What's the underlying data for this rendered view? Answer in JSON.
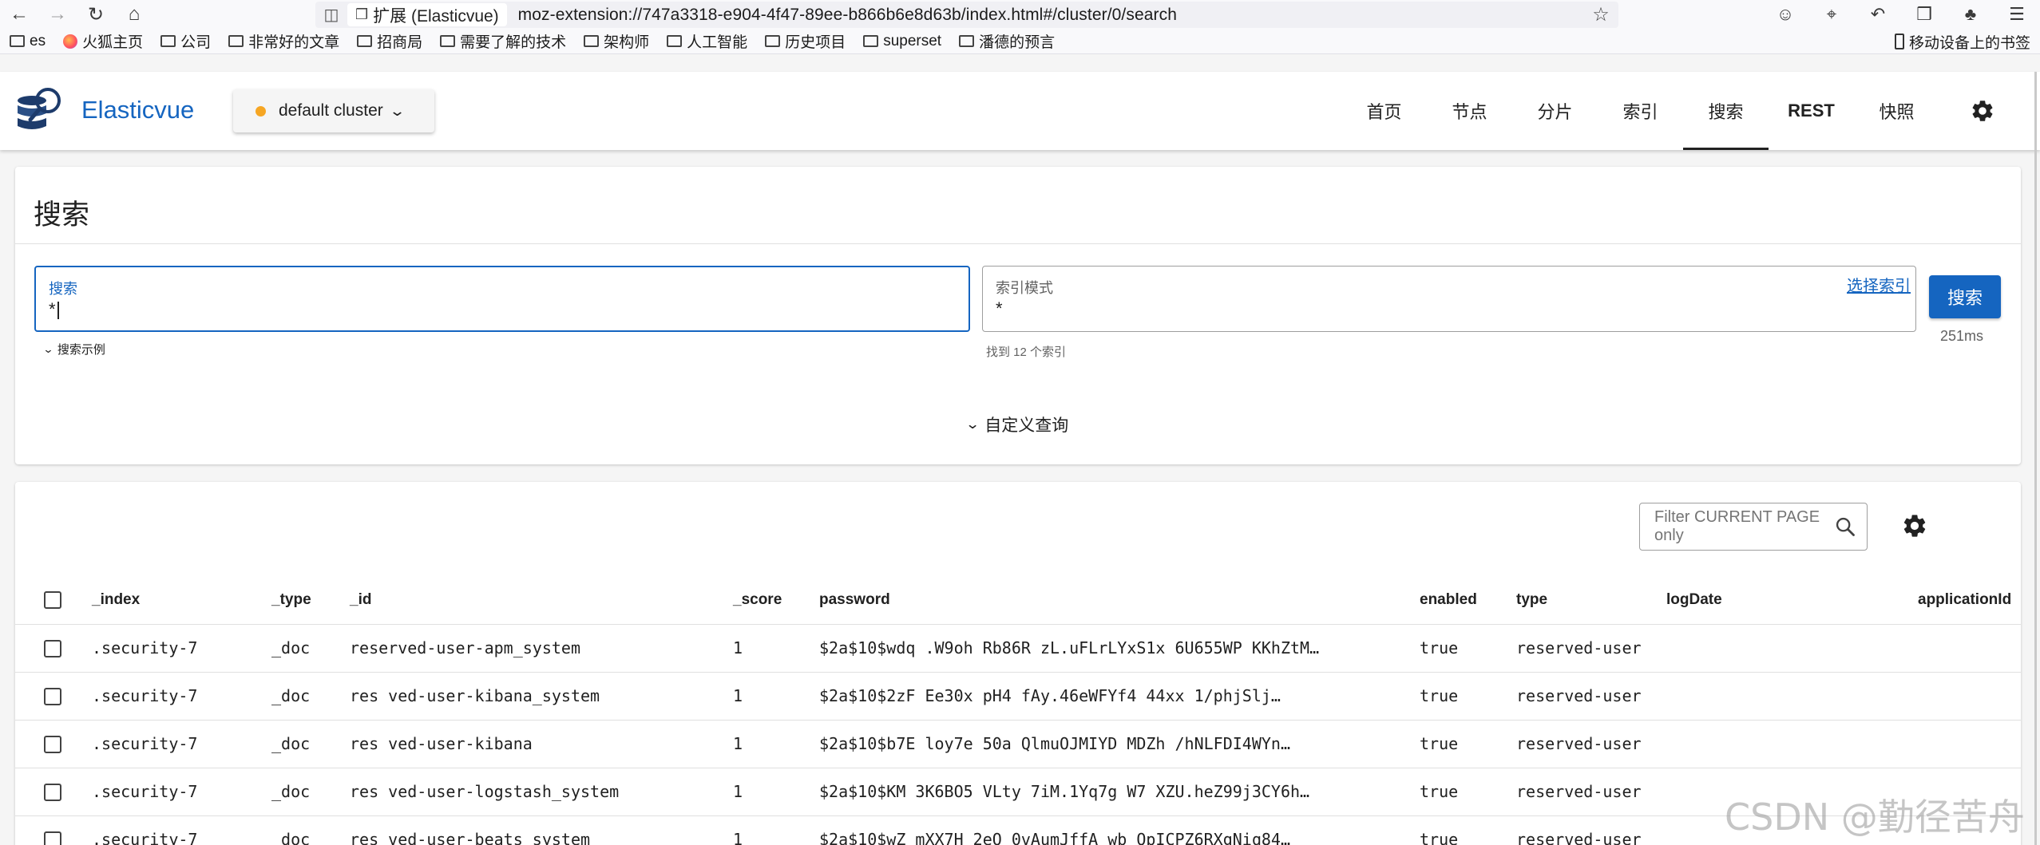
{
  "browser": {
    "ext_chip": "扩展 (Elasticvue)",
    "url": "moz-extension://747a3318-e904-4f47-89ee-b866b6e8d63b/index.html#/cluster/0/search",
    "bookmarks": [
      {
        "label": "es",
        "icon": "folder-icon"
      },
      {
        "label": "火狐主页",
        "icon": "firefox-icon"
      },
      {
        "label": "公司",
        "icon": "folder-icon"
      },
      {
        "label": "非常好的文章",
        "icon": "folder-icon"
      },
      {
        "label": "招商局",
        "icon": "folder-icon"
      },
      {
        "label": "需要了解的技术",
        "icon": "folder-icon"
      },
      {
        "label": "架构师",
        "icon": "folder-icon"
      },
      {
        "label": "人工智能",
        "icon": "folder-icon"
      },
      {
        "label": "历史项目",
        "icon": "folder-icon"
      },
      {
        "label": "superset",
        "icon": "folder-icon"
      },
      {
        "label": "潘德的预言",
        "icon": "folder-icon"
      }
    ],
    "mobile_bookmarks": "移动设备上的书签"
  },
  "app": {
    "name": "Elasticvue",
    "cluster": "default cluster",
    "cluster_status_color": "#f6a623",
    "brand_color": "#1565c0",
    "nav": [
      {
        "label": "首页",
        "active": false
      },
      {
        "label": "节点",
        "active": false
      },
      {
        "label": "分片",
        "active": false
      },
      {
        "label": "索引",
        "active": false
      },
      {
        "label": "搜索",
        "active": true
      },
      {
        "label": "REST",
        "active": false
      },
      {
        "label": "快照",
        "active": false
      }
    ]
  },
  "search": {
    "title": "搜索",
    "query_label": "搜索",
    "query_value": "*",
    "examples_toggle": "搜索示例",
    "index_label": "索引模式",
    "index_value": "*",
    "pick_index": "选择索引",
    "found_hint": "找到 12 个索引",
    "search_button": "搜索",
    "took": "251ms",
    "custom_query": "自定义查询"
  },
  "results": {
    "filter_placeholder": "Filter CURRENT PAGE only",
    "columns": [
      "_index",
      "_type",
      "_id",
      "_score",
      "password",
      "enabled",
      "type",
      "logDate",
      "applicationId"
    ],
    "rows": [
      {
        "_index": ".security-7",
        "_type": "_doc",
        "_id": "reserved-user-apm_system",
        "_score": "1",
        "password": "$2a$10$wdq .W9oh Rb86R zL.uFLrLYxS1x 6U655WP KKhZtM…",
        "enabled": "true",
        "type": "reserved-user",
        "logDate": "",
        "applicationId": ""
      },
      {
        "_index": ".security-7",
        "_type": "_doc",
        "_id": "res ved-user-kibana_system",
        "_score": "1",
        "password": "$2a$10$2zF Ee30x pH4 fAy.46eWFYf4 44xx 1/phjSlj…",
        "enabled": "true",
        "type": "reserved-user",
        "logDate": "",
        "applicationId": ""
      },
      {
        "_index": ".security-7",
        "_type": "_doc",
        "_id": "res ved-user-kibana",
        "_score": "1",
        "password": "$2a$10$b7E loy7e 50a QlmuOJMIYD MDZh /hNLFDI4WYn…",
        "enabled": "true",
        "type": "reserved-user",
        "logDate": "",
        "applicationId": ""
      },
      {
        "_index": ".security-7",
        "_type": "_doc",
        "_id": "res ved-user-logstash_system",
        "_score": "1",
        "password": "$2a$10$KM 3K6BO5 VLty 7iM.1Yq7g W7 XZU.heZ99j3CY6h…",
        "enabled": "true",
        "type": "reserved-user",
        "logDate": "",
        "applicationId": ""
      },
      {
        "_index": ".security-7",
        "_type": "_doc",
        "_id": "res ved-user-beats_system",
        "_score": "1",
        "password": "$2a$10$wZ mXX7H 2eO 0vAumJffA wb QpICPZ6RXgNiq84…",
        "enabled": "true",
        "type": "reserved-user",
        "logDate": "",
        "applicationId": ""
      }
    ]
  },
  "watermark": "CSDN @勤径苦舟"
}
